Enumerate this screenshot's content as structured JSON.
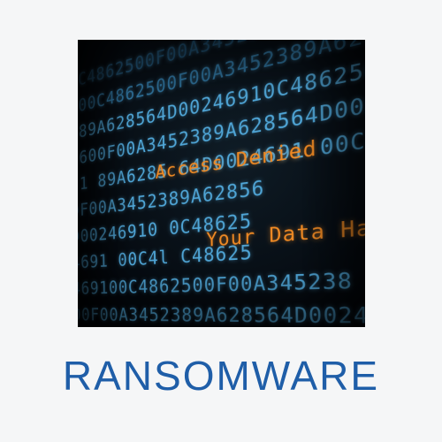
{
  "hero": {
    "alert_primary": "Access Denied",
    "alert_secondary": "Your Data Has Been Encrypted",
    "accent_color": "#f08a24",
    "code_color": "#4fa5d6"
  },
  "caption": {
    "title": "RANSOMWARE",
    "color": "#1f5ea8"
  }
}
